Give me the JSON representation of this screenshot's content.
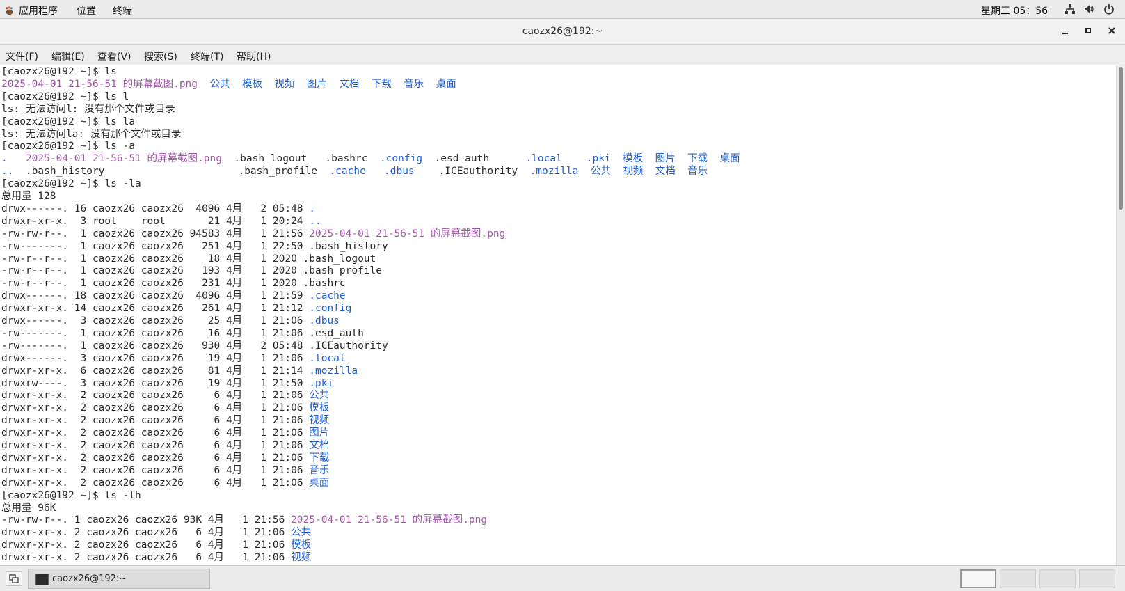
{
  "top_panel": {
    "apps_label": "应用程序",
    "places_label": "位置",
    "terminal_label": "终端",
    "clock": "星期三 05：56",
    "tray_icons": [
      "network-icon",
      "volume-icon",
      "power-icon"
    ]
  },
  "window": {
    "title": "caozx26@192:~",
    "buttons": [
      "minimize",
      "maximize",
      "close"
    ]
  },
  "menubar": {
    "items": [
      "文件(F)",
      "编辑(E)",
      "查看(V)",
      "搜索(S)",
      "终端(T)",
      "帮助(H)"
    ]
  },
  "terminal": {
    "colors": {
      "directory": "#1e5fd6",
      "image": "#a258a8",
      "text": "#2a2a2a"
    },
    "lines": [
      [
        [
          "[caozx26@192 ~]$ ls",
          "t"
        ]
      ],
      [
        [
          "2025-04-01 21-56-51 的屏幕截图.png",
          "i"
        ],
        [
          "  ",
          "t"
        ],
        [
          "公共",
          "d"
        ],
        [
          "  ",
          "t"
        ],
        [
          "模板",
          "d"
        ],
        [
          "  ",
          "t"
        ],
        [
          "视频",
          "d"
        ],
        [
          "  ",
          "t"
        ],
        [
          "图片",
          "d"
        ],
        [
          "  ",
          "t"
        ],
        [
          "文档",
          "d"
        ],
        [
          "  ",
          "t"
        ],
        [
          "下载",
          "d"
        ],
        [
          "  ",
          "t"
        ],
        [
          "音乐",
          "d"
        ],
        [
          "  ",
          "t"
        ],
        [
          "桌面",
          "d"
        ]
      ],
      [
        [
          "[caozx26@192 ~]$ ls l",
          "t"
        ]
      ],
      [
        [
          "ls: 无法访问l: 没有那个文件或目录",
          "t"
        ]
      ],
      [
        [
          "[caozx26@192 ~]$ ls la",
          "t"
        ]
      ],
      [
        [
          "ls: 无法访问la: 没有那个文件或目录",
          "t"
        ]
      ],
      [
        [
          "[caozx26@192 ~]$ ls -a",
          "t"
        ]
      ],
      [
        [
          ".",
          "d"
        ],
        [
          "   ",
          "t"
        ],
        [
          "2025-04-01 21-56-51 的屏幕截图.png",
          "i"
        ],
        [
          "  .bash_logout   .bashrc  ",
          "t"
        ],
        [
          ".config",
          "d"
        ],
        [
          "  .esd_auth      ",
          "t"
        ],
        [
          ".local",
          "d"
        ],
        [
          "    ",
          "t"
        ],
        [
          ".pki",
          "d"
        ],
        [
          "  ",
          "t"
        ],
        [
          "模板",
          "d"
        ],
        [
          "  ",
          "t"
        ],
        [
          "图片",
          "d"
        ],
        [
          "  ",
          "t"
        ],
        [
          "下载",
          "d"
        ],
        [
          "  ",
          "t"
        ],
        [
          "桌面",
          "d"
        ]
      ],
      [
        [
          "..",
          "d"
        ],
        [
          "  .bash_history                      .bash_profile  ",
          "t"
        ],
        [
          ".cache",
          "d"
        ],
        [
          "   ",
          "t"
        ],
        [
          ".dbus",
          "d"
        ],
        [
          "    .ICEauthority  ",
          "t"
        ],
        [
          ".mozilla",
          "d"
        ],
        [
          "  ",
          "t"
        ],
        [
          "公共",
          "d"
        ],
        [
          "  ",
          "t"
        ],
        [
          "视频",
          "d"
        ],
        [
          "  ",
          "t"
        ],
        [
          "文档",
          "d"
        ],
        [
          "  ",
          "t"
        ],
        [
          "音乐",
          "d"
        ]
      ],
      [
        [
          "[caozx26@192 ~]$ ls -la",
          "t"
        ]
      ],
      [
        [
          "总用量 128",
          "t"
        ]
      ],
      [
        [
          "drwx------. 16 caozx26 caozx26  4096 4月   2 05:48 ",
          "t"
        ],
        [
          ".",
          "d"
        ]
      ],
      [
        [
          "drwxr-xr-x.  3 root    root       21 4月   1 20:24 ",
          "t"
        ],
        [
          "..",
          "d"
        ]
      ],
      [
        [
          "-rw-rw-r--.  1 caozx26 caozx26 94583 4月   1 21:56 ",
          "t"
        ],
        [
          "2025-04-01 21-56-51 的屏幕截图.png",
          "i"
        ]
      ],
      [
        [
          "-rw-------.  1 caozx26 caozx26   251 4月   1 22:50 .bash_history",
          "t"
        ]
      ],
      [
        [
          "-rw-r--r--.  1 caozx26 caozx26    18 4月   1 2020 .bash_logout",
          "t"
        ]
      ],
      [
        [
          "-rw-r--r--.  1 caozx26 caozx26   193 4月   1 2020 .bash_profile",
          "t"
        ]
      ],
      [
        [
          "-rw-r--r--.  1 caozx26 caozx26   231 4月   1 2020 .bashrc",
          "t"
        ]
      ],
      [
        [
          "drwx------. 18 caozx26 caozx26  4096 4月   1 21:59 ",
          "t"
        ],
        [
          ".cache",
          "d"
        ]
      ],
      [
        [
          "drwxr-xr-x. 14 caozx26 caozx26   261 4月   1 21:12 ",
          "t"
        ],
        [
          ".config",
          "d"
        ]
      ],
      [
        [
          "drwx------.  3 caozx26 caozx26    25 4月   1 21:06 ",
          "t"
        ],
        [
          ".dbus",
          "d"
        ]
      ],
      [
        [
          "-rw-------.  1 caozx26 caozx26    16 4月   1 21:06 .esd_auth",
          "t"
        ]
      ],
      [
        [
          "-rw-------.  1 caozx26 caozx26   930 4月   2 05:48 .ICEauthority",
          "t"
        ]
      ],
      [
        [
          "drwx------.  3 caozx26 caozx26    19 4月   1 21:06 ",
          "t"
        ],
        [
          ".local",
          "d"
        ]
      ],
      [
        [
          "drwxr-xr-x.  6 caozx26 caozx26    81 4月   1 21:14 ",
          "t"
        ],
        [
          ".mozilla",
          "d"
        ]
      ],
      [
        [
          "drwxrw----.  3 caozx26 caozx26    19 4月   1 21:50 ",
          "t"
        ],
        [
          ".pki",
          "d"
        ]
      ],
      [
        [
          "drwxr-xr-x.  2 caozx26 caozx26     6 4月   1 21:06 ",
          "t"
        ],
        [
          "公共",
          "d"
        ]
      ],
      [
        [
          "drwxr-xr-x.  2 caozx26 caozx26     6 4月   1 21:06 ",
          "t"
        ],
        [
          "模板",
          "d"
        ]
      ],
      [
        [
          "drwxr-xr-x.  2 caozx26 caozx26     6 4月   1 21:06 ",
          "t"
        ],
        [
          "视频",
          "d"
        ]
      ],
      [
        [
          "drwxr-xr-x.  2 caozx26 caozx26     6 4月   1 21:06 ",
          "t"
        ],
        [
          "图片",
          "d"
        ]
      ],
      [
        [
          "drwxr-xr-x.  2 caozx26 caozx26     6 4月   1 21:06 ",
          "t"
        ],
        [
          "文档",
          "d"
        ]
      ],
      [
        [
          "drwxr-xr-x.  2 caozx26 caozx26     6 4月   1 21:06 ",
          "t"
        ],
        [
          "下载",
          "d"
        ]
      ],
      [
        [
          "drwxr-xr-x.  2 caozx26 caozx26     6 4月   1 21:06 ",
          "t"
        ],
        [
          "音乐",
          "d"
        ]
      ],
      [
        [
          "drwxr-xr-x.  2 caozx26 caozx26     6 4月   1 21:06 ",
          "t"
        ],
        [
          "桌面",
          "d"
        ]
      ],
      [
        [
          "[caozx26@192 ~]$ ls -lh",
          "t"
        ]
      ],
      [
        [
          "总用量 96K",
          "t"
        ]
      ],
      [
        [
          "-rw-rw-r--. 1 caozx26 caozx26 93K 4月   1 21:56 ",
          "t"
        ],
        [
          "2025-04-01 21-56-51 的屏幕截图.png",
          "i"
        ]
      ],
      [
        [
          "drwxr-xr-x. 2 caozx26 caozx26   6 4月   1 21:06 ",
          "t"
        ],
        [
          "公共",
          "d"
        ]
      ],
      [
        [
          "drwxr-xr-x. 2 caozx26 caozx26   6 4月   1 21:06 ",
          "t"
        ],
        [
          "模板",
          "d"
        ]
      ],
      [
        [
          "drwxr-xr-x. 2 caozx26 caozx26   6 4月   1 21:06 ",
          "t"
        ],
        [
          "视频",
          "d"
        ]
      ]
    ]
  },
  "taskbar": {
    "task_label": "caozx26@192:~",
    "workspaces": 4
  }
}
